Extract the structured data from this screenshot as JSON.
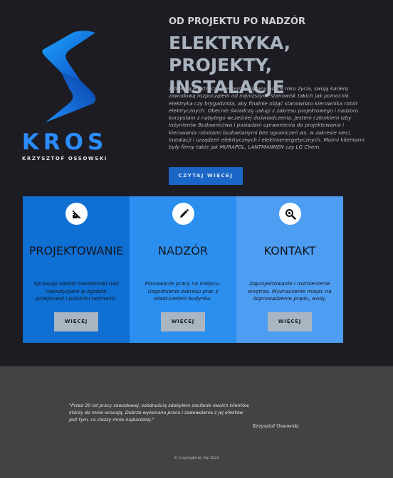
{
  "brand": {
    "name": "KROS",
    "subtitle": "KRZYSZTOF OSSOWSKI",
    "logo_icon": "stylized-s-logo-icon"
  },
  "hero": {
    "eyebrow": "OD PROJEKTU PO NADZÓR",
    "headline": "ELEKTRYKA, PROJEKTY, INSTALACJE",
    "intro": "Z branżą elektryczną jestem związany od 19 roku życia, swoją karierę zawodową rozpocząłem od najniższych stanowisk takich jak pomocnik elektryka czy brygadzista, aby finalnie objąć stanowisko kierownika robót elektrycznych. Obecnie świadczę usługi z zakresu projektowego i nadzoru korzystam z nabytego wcześniej doświadczenia. Jestem członkiem Izby Inżynierów Budownictwa i posiadam uprawnienia do projektowania i kierowania robotami budowlanymi bez ograniczeń ws. w zakresie sieci, instalacji i urządzeń elektrycznych i elektroenergetycznych. Moimi klientami były firmy takie jak MURAPOL, LANTMANNEN czy LG Chem.",
    "cta_label": "CZYTAJ WIĘCEJ"
  },
  "cards": [
    {
      "title": "PROJEKTOWANIE",
      "text": "Sprawuję nadzór inwestorski nad inwestycjami w zgodzie przepisami i polskimi normami.",
      "button": "WIĘCEJ",
      "icon": "ruler-triangle-icon",
      "color": "#0f6fd2"
    },
    {
      "title": "NADZÓR",
      "text": "Planowanie pracy na miejscu. Uzgodnienie zakresu prac z właścicielem budynku.",
      "button": "WIĘCEJ",
      "icon": "pencil-icon",
      "color": "#2b8ff0"
    },
    {
      "title": "KONTAKT",
      "text": "Zaprojektowanie i rozmierzenie wnętrza. Wyznaczenie miejsc na doprowadzenie prądu, wody.",
      "button": "WIĘCEJ",
      "icon": "search-icon",
      "color": "#4d9df2"
    }
  ],
  "footer": {
    "quote": "\"Przez 20 lat pracy zawodowej, solidnością zdobyłem zaufanie swoich klientów, którzy do mnie wracają. Dobrze wykonana praca i zadowolenie z jej efektów jest tym, co cieszy mnie najbardziej.\"",
    "author": "Krzysztof Ossowski",
    "copyright": "© Copyright by My 2022"
  },
  "colors": {
    "background": "#1d1c22",
    "accent": "#1a66c6",
    "footer": "#434343"
  }
}
